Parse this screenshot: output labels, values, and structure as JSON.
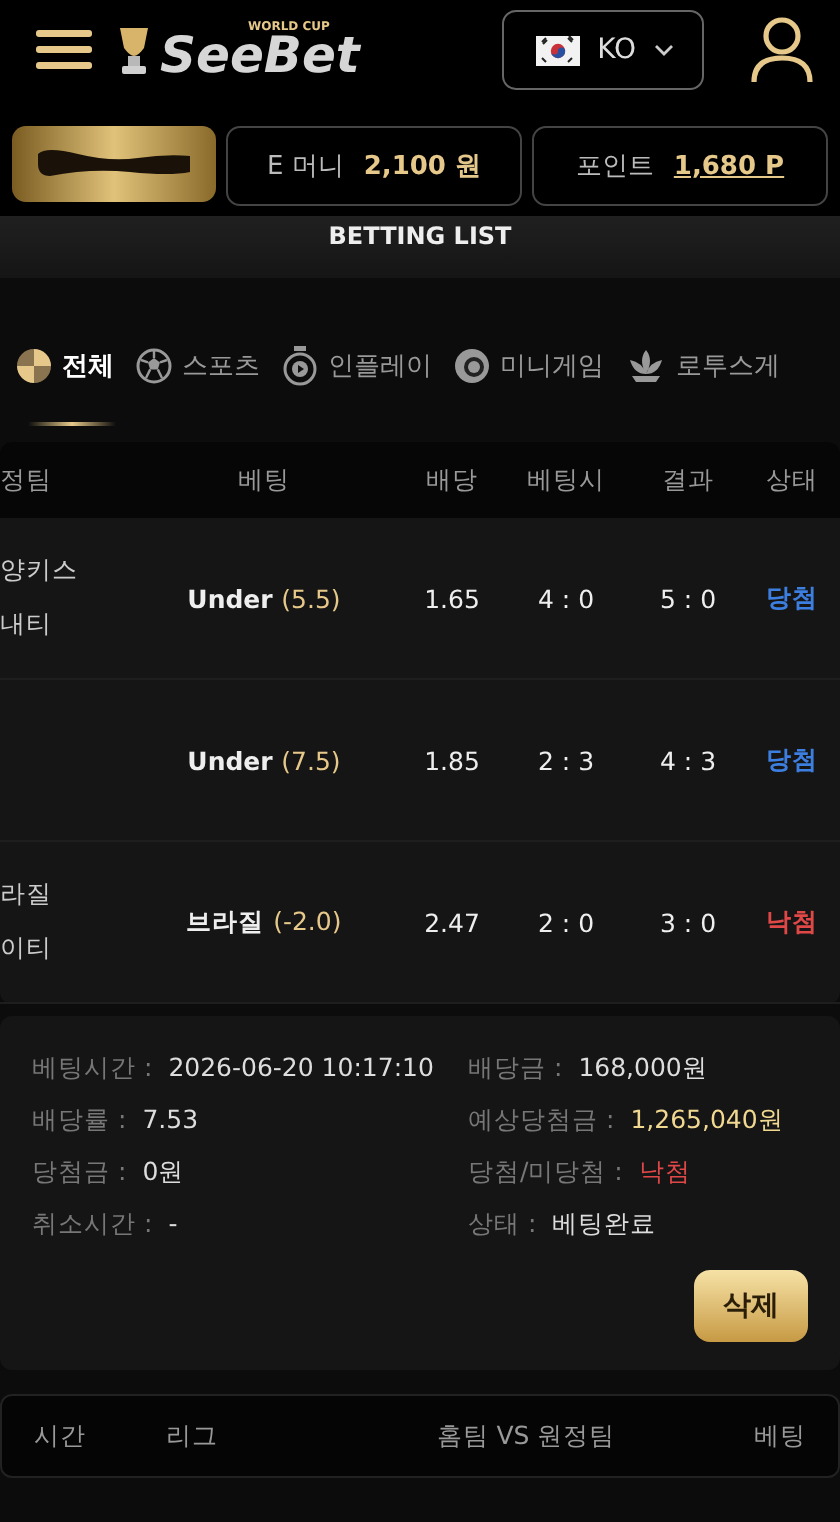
{
  "header": {
    "logo_small": "WORLD CUP",
    "logo": "SeeBet",
    "language": "KO"
  },
  "balances": [
    {
      "label": "E 머니",
      "value": "2,100 원",
      "underline": false
    },
    {
      "label": "포인트",
      "value": "1,680 P",
      "underline": true
    }
  ],
  "section_title": "BETTING LIST",
  "tabs": [
    {
      "label": "전체",
      "selected": true,
      "kind": "all"
    },
    {
      "label": "스포츠",
      "selected": false,
      "kind": "sports"
    },
    {
      "label": "인플레이",
      "selected": false,
      "kind": "inplay"
    },
    {
      "label": "미니게임",
      "selected": false,
      "kind": "mini"
    },
    {
      "label": "로투스게",
      "selected": false,
      "kind": "lotus"
    }
  ],
  "table": {
    "columns": [
      "정팀",
      "베팅",
      "배당",
      "베팅시",
      "결과",
      "상태"
    ],
    "rows": [
      {
        "teams": [
          "양키스",
          "내티"
        ],
        "pick": "Under",
        "line": "(5.5)",
        "odds": "1.65",
        "bet_score": "4 : 0",
        "result": "5 : 0",
        "status": "당첨",
        "color": "#3d7fe0"
      },
      {
        "teams": [],
        "pick": "Under",
        "line": "(7.5)",
        "odds": "1.85",
        "bet_score": "2 : 3",
        "result": "4 : 3",
        "status": "당첨",
        "color": "#3d7fe0"
      },
      {
        "teams": [
          "라질",
          "이티"
        ],
        "pick": "브라질",
        "line": "(-2.0)",
        "odds": "2.47",
        "bet_score": "2 : 0",
        "result": "3 : 0",
        "status": "낙첨",
        "color": "#e04848"
      }
    ]
  },
  "details": [
    {
      "label": "베팅시간 :",
      "value": "2026-06-20 10:17:10",
      "color": "#dddddd"
    },
    {
      "label": "배당금 :",
      "value": "168,000원",
      "color": "#dddddd"
    },
    {
      "label": "배당률 :",
      "value": "7.53",
      "color": "#dddddd"
    },
    {
      "label": "예상당첨금 :",
      "value": "1,265,040원",
      "color": "#f0d890"
    },
    {
      "label": "당첨금 :",
      "value": "0원",
      "color": "#dddddd"
    },
    {
      "label": "당첨/미당첨 :",
      "value": "낙첨",
      "color": "#e04848"
    },
    {
      "label": "취소시간 :",
      "value": "-",
      "color": "#dddddd"
    },
    {
      "label": "상태 :",
      "value": "베팅완료",
      "color": "#dddddd"
    }
  ],
  "delete_button": "삭제",
  "bottom_table": {
    "columns": [
      "시간",
      "리그",
      "홈팀 VS 원정팀",
      "베팅"
    ]
  }
}
